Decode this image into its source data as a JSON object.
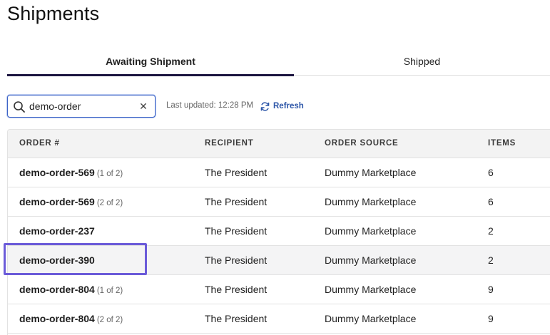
{
  "page": {
    "title": "Shipments"
  },
  "tabs": [
    {
      "label": "Awaiting Shipment",
      "active": true
    },
    {
      "label": "Shipped",
      "active": false
    }
  ],
  "search": {
    "value": "demo-order",
    "placeholder": "",
    "last_updated": "Last updated: 12:28 PM",
    "refresh_label": "Refresh"
  },
  "table": {
    "headers": [
      "ORDER #",
      "RECIPIENT",
      "ORDER SOURCE",
      "ITEMS"
    ],
    "rows": [
      {
        "order": "demo-order-569",
        "part": "(1 of 2)",
        "recipient": "The President",
        "source": "Dummy Marketplace",
        "items": "6"
      },
      {
        "order": "demo-order-569",
        "part": "(2 of 2)",
        "recipient": "The President",
        "source": "Dummy Marketplace",
        "items": "6"
      },
      {
        "order": "demo-order-237",
        "part": "",
        "recipient": "The President",
        "source": "Dummy Marketplace",
        "items": "2"
      },
      {
        "order": "demo-order-390",
        "part": "",
        "recipient": "The President",
        "source": "Dummy Marketplace",
        "items": "2"
      },
      {
        "order": "demo-order-804",
        "part": "(1 of 2)",
        "recipient": "The President",
        "source": "Dummy Marketplace",
        "items": "9"
      },
      {
        "order": "demo-order-804",
        "part": "(2 of 2)",
        "recipient": "The President",
        "source": "Dummy Marketplace",
        "items": "9"
      }
    ]
  },
  "colors": {
    "active_tab_bar": "#1c1540",
    "link_blue": "#2d56a8",
    "highlight_outline": "#6b5bd9"
  },
  "icons": {
    "search": "search-icon",
    "clear": "close-icon",
    "refresh": "refresh-icon"
  }
}
